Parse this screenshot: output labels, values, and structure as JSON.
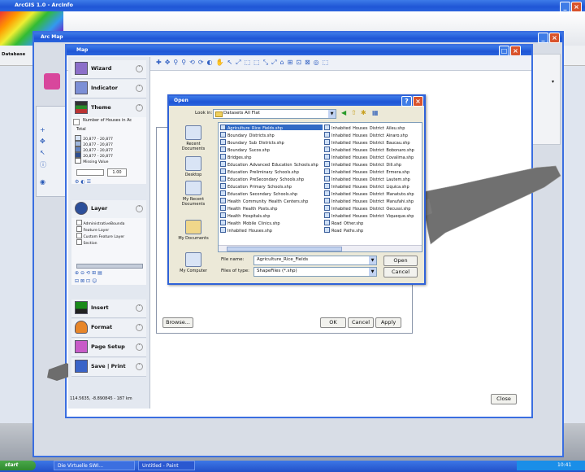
{
  "outer_window": {
    "title": "ArcGIS 1.0 - ArcInfo",
    "left_label": "Database"
  },
  "tool_window": {
    "title": "Arc Map"
  },
  "map_window": {
    "title": "Map"
  },
  "sidebar": {
    "sections": [
      {
        "label": "Wizard"
      },
      {
        "label": "Indicator"
      },
      {
        "label": "Theme"
      },
      {
        "label": "Layer"
      },
      {
        "label": "Insert"
      },
      {
        "label": "Format"
      },
      {
        "label": "Page Setup"
      },
      {
        "label": "Save | Print"
      }
    ],
    "theme_title": "Number of Houses in Ac",
    "theme_subtitle": "Total",
    "legend": [
      "20,877 - 20,877",
      "20,877 - 20,877",
      "20,877 - 20,877",
      "20,877 - 20,877",
      "Missing Value"
    ],
    "legend_colors": [
      "#d7e3f3",
      "#9fb7dc",
      "#6384c1",
      "#2f4f8f",
      "#ffffff"
    ],
    "size_value": "1.00",
    "layers": [
      "AdministrativeBounda",
      "Feature Layer",
      "Custom Feature Layer",
      "Section"
    ]
  },
  "status": {
    "coordinates": "114.5635, -8.890845 - 187 km"
  },
  "buttons": {
    "browse": "Browse...",
    "ok": "OK",
    "cancel": "Cancel",
    "apply": "Apply",
    "close": "Close"
  },
  "open_dialog": {
    "title": "Open",
    "look_in_label": "Look in:",
    "look_in_value": "Datasets All Flat",
    "places": [
      "Recent Documents",
      "Desktop",
      "My Recent Documents",
      "My Documents",
      "My Computer"
    ],
    "files_left": [
      "Agriculture_Rice_Fields.shp",
      "Boundary_Districts.shp",
      "Boundary_Sub_Districts.shp",
      "Boundary_Sucos.shp",
      "Bridges.shp",
      "Education_Advanced_Education_Schools.shp",
      "Education_Preliminary_Schools.shp",
      "Education_PreSecondary_Schools.shp",
      "Education_Primary_Schools.shp",
      "Education_Secondary_Schools.shp",
      "Health_Community_Health_Centers.shp",
      "Health_Health_Posts.shp",
      "Health_Hospitals.shp",
      "Health_Mobile_Clinics.shp",
      "Inhabited_Houses.shp"
    ],
    "files_right": [
      "Inhabited_Houses_District_Aileu.shp",
      "Inhabited_Houses_District_Ainaro.shp",
      "Inhabited_Houses_District_Baucau.shp",
      "Inhabited_Houses_District_Bobonaro.shp",
      "Inhabited_Houses_District_Covalima.shp",
      "Inhabited_Houses_District_Dili.shp",
      "Inhabited_Houses_District_Ermera.shp",
      "Inhabited_Houses_District_Lautem.shp",
      "Inhabited_Houses_District_Liquica.shp",
      "Inhabited_Houses_District_Manatuto.shp",
      "Inhabited_Houses_District_Manufahi.shp",
      "Inhabited_Houses_District_Oecussi.shp",
      "Inhabited_Houses_District_Viqueque.shp",
      "Road_Other.shp",
      "Road_Paths.shp"
    ],
    "file_name_label": "File name:",
    "file_name_value": "Agriculture_Rice_Fields",
    "file_type_label": "Files of type:",
    "file_type_value": "ShapeFiles (*.shp)",
    "open_label": "Open",
    "cancel_label": "Cancel"
  },
  "taskbar": {
    "start": "start",
    "items": [
      "Die Virtuelle SWI...",
      "Untitled - Paint"
    ],
    "time": "10:41"
  }
}
